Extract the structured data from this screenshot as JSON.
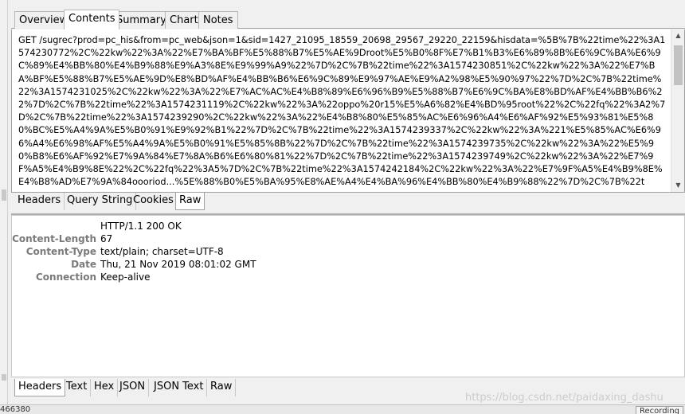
{
  "top_tabs": [
    "Overview",
    "Contents",
    "Summary",
    "Chart",
    "Notes"
  ],
  "request": {
    "text": "GET /sugrec?prod=pc_his&from=pc_web&json=1&sid=1427_21095_18559_20698_29567_29220_22159&hisdata=%5B%7B%22time%22%3A1574230772%2C%22kw%22%3A%22%E7%BA%BF%E5%88%B7%E5%AE%9Droot%E5%B0%8F%E7%B1%B3%E6%89%8B%E6%9C%BA%E6%9C%89%E4%BB%80%E4%B9%88%E9%A3%8E%E9%99%A9%22%7D%2C%7B%22time%22%3A1574230851%2C%22kw%22%3A%22%E7%BA%BF%E5%88%B7%E5%AE%9D%E8%BD%AF%E4%BB%B6%E6%9C%89%E9%97%AE%E9%A2%98%E5%90%97%22%7D%2C%7B%22time%22%3A1574231025%2C%22kw%22%3A%22%E7%AC%AC%E4%B8%89%E6%96%B9%E5%88%B7%E6%9C%BA%E8%BD%AF%E4%BB%B6%22%7D%2C%7B%22time%22%3A1574231119%2C%22kw%22%3A%22oppo%20r15%E5%A6%82%E4%BD%95root%22%2C%22fq%22%3A2%7D%2C%7B%22time%22%3A1574239290%2C%22kw%22%3A%22%E4%B8%80%E5%85%AC%E6%96%A4%E6%AF%92%E5%93%81%E5%80%BC%E5%A4%9A%E5%B0%91%E9%92%B1%22%7D%2C%7B%22time%22%3A1574239337%2C%22kw%22%3A%221%E5%85%AC%E6%96%A4%E6%98%AF%E5%A4%9A%E5%B0%91%E5%85%8B%22%7D%2C%7B%22time%22%3A1574239735%2C%22kw%22%3A%22%E5%90%B8%E6%AF%92%E7%9A%84%E7%8A%B6%E6%80%81%22%7D%2C%7B%22time%22%3A1574239749%2C%22kw%22%3A%22%E7%9F%A5%E4%B9%8E%22%2C%22fq%22%3A5%7D%2C%7B%22time%22%3A1574242184%2C%22kw%22%3A%22%E7%9F%A5%E4%B9%8E%E4%B8%AD%E7%9A%84oooriod...%5E%88%B0%E5%BA%95%E8%AE%A4%E4%BA%96%E4%BB%80%E4%B9%88%22%7D%2C%7B%22t"
  },
  "request_subtabs": [
    "Headers",
    "Query String",
    "Cookies",
    "Raw"
  ],
  "response": {
    "status_line": "HTTP/1.1 200 OK",
    "headers": [
      {
        "key": "Content-Length",
        "value": "67"
      },
      {
        "key": "Content-Type",
        "value": "text/plain; charset=UTF-8"
      },
      {
        "key": "Date",
        "value": "Thu, 21 Nov 2019 08:01:02 GMT"
      },
      {
        "key": "Connection",
        "value": "Keep-alive"
      }
    ]
  },
  "response_subtabs": [
    "Headers",
    "Text",
    "Hex",
    "JSON",
    "JSON Text",
    "Raw"
  ],
  "status": {
    "left": "466380",
    "right": "Recording"
  },
  "watermark": "https://blog.csdn.net/paidaxing_dashu"
}
